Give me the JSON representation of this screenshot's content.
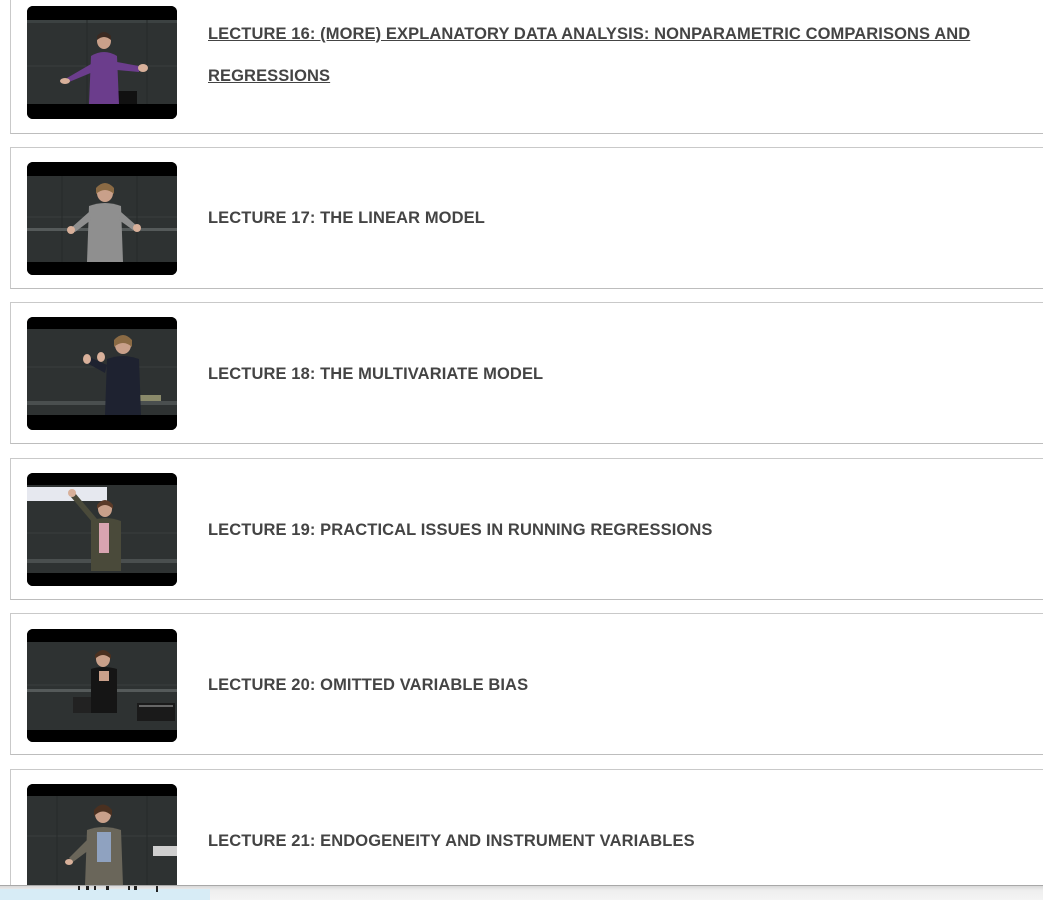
{
  "lectures": [
    {
      "title": "LECTURE 16: (MORE) EXPLANATORY DATA ANALYSIS: NONPARAMETRIC COMPARISONS AND REGRESSIONS",
      "thumbnail_icon": "video-thumbnail"
    },
    {
      "title": "LECTURE 17: THE LINEAR MODEL",
      "thumbnail_icon": "video-thumbnail"
    },
    {
      "title": "LECTURE 18: THE MULTIVARIATE MODEL",
      "thumbnail_icon": "video-thumbnail"
    },
    {
      "title": "LECTURE 19: PRACTICAL ISSUES IN RUNNING REGRESSIONS",
      "thumbnail_icon": "video-thumbnail"
    },
    {
      "title": "LECTURE 20: OMITTED VARIABLE BIAS",
      "thumbnail_icon": "video-thumbnail"
    },
    {
      "title": "LECTURE 21: ENDOGENEITY AND INSTRUMENT VARIABLES",
      "thumbnail_icon": "video-thumbnail"
    }
  ],
  "colors": {
    "title_text": "#444444",
    "border": "#c9c9c9",
    "thumbnail_background": "#000000",
    "chalkboard": "#2b2f2f"
  }
}
